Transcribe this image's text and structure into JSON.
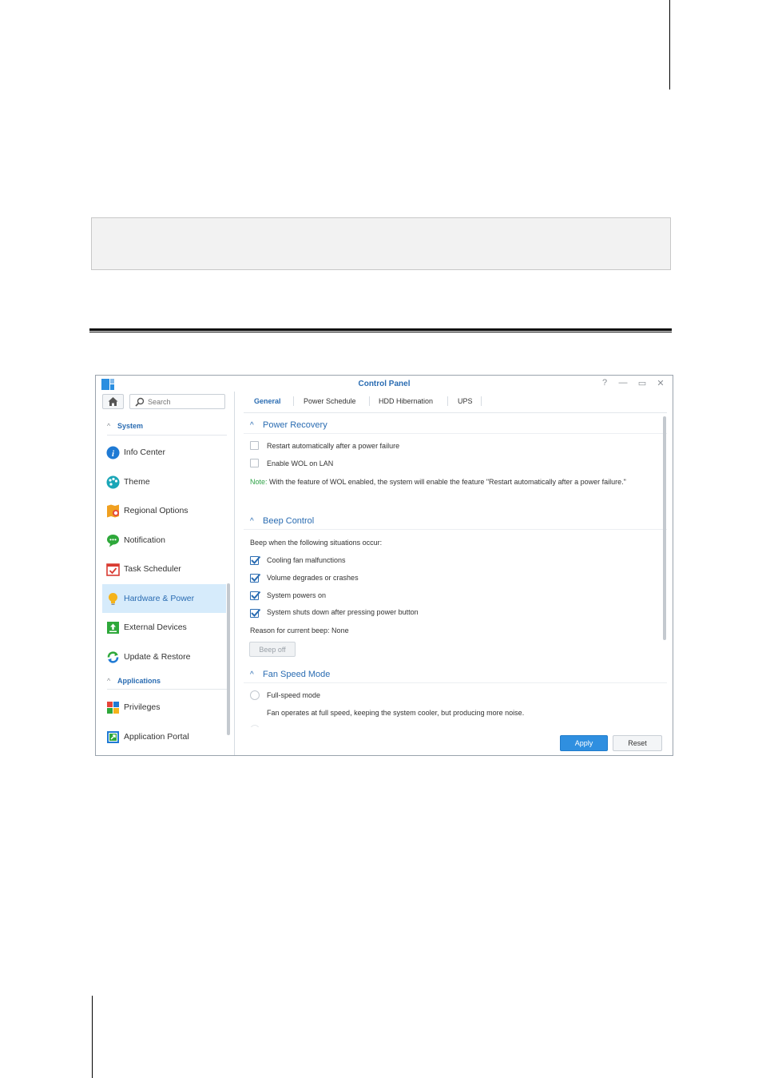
{
  "window": {
    "title": "Control Panel",
    "controls": {
      "help": "?",
      "minimize": "—",
      "maximize": "▭",
      "close": "✕"
    }
  },
  "sidebar": {
    "search_placeholder": "Search",
    "sections": [
      {
        "label": "System"
      },
      {
        "label": "Applications"
      }
    ],
    "items": [
      {
        "label": "Info Center",
        "icon": "info-icon"
      },
      {
        "label": "Theme",
        "icon": "palette-icon"
      },
      {
        "label": "Regional Options",
        "icon": "regional-options-icon"
      },
      {
        "label": "Notification",
        "icon": "chat-bubble-icon"
      },
      {
        "label": "Task Scheduler",
        "icon": "calendar-check-icon"
      },
      {
        "label": "Hardware & Power",
        "icon": "lightbulb-icon",
        "active": true
      },
      {
        "label": "External Devices",
        "icon": "external-device-icon"
      },
      {
        "label": "Update & Restore",
        "icon": "refresh-icon"
      },
      {
        "label": "Privileges",
        "icon": "privileges-grid-icon"
      },
      {
        "label": "Application Portal",
        "icon": "app-portal-icon"
      }
    ]
  },
  "tabs": [
    {
      "label": "General",
      "active": true
    },
    {
      "label": "Power Schedule"
    },
    {
      "label": "HDD Hibernation"
    },
    {
      "label": "UPS"
    }
  ],
  "power_recovery": {
    "title": "Power Recovery",
    "options": [
      {
        "label": "Restart automatically after a power failure",
        "checked": false
      },
      {
        "label": "Enable WOL on LAN",
        "checked": false
      }
    ],
    "note_label": "Note:",
    "note_text": " With the feature of WOL enabled, the system will enable the feature \"Restart automatically after a power failure.\""
  },
  "beep_control": {
    "title": "Beep Control",
    "intro": "Beep when the following situations occur:",
    "options": [
      {
        "label": "Cooling fan malfunctions",
        "checked": true
      },
      {
        "label": "Volume degrades or crashes",
        "checked": true
      },
      {
        "label": "System powers on",
        "checked": true
      },
      {
        "label": "System shuts down after pressing power button",
        "checked": true
      }
    ],
    "reason": "Reason for current beep: None",
    "beep_off_label": "Beep off"
  },
  "fan_speed": {
    "title": "Fan Speed Mode",
    "options": [
      {
        "label": "Full-speed mode",
        "description": "Fan operates at full speed, keeping the system cooler, but producing more noise."
      }
    ]
  },
  "footer": {
    "apply_label": "Apply",
    "reset_label": "Reset"
  },
  "colors": {
    "accent": "#2a6cb2",
    "apply_button": "#2f8fe0",
    "active_item_bg": "#d6ebfb",
    "note_label": "#2ea246"
  }
}
